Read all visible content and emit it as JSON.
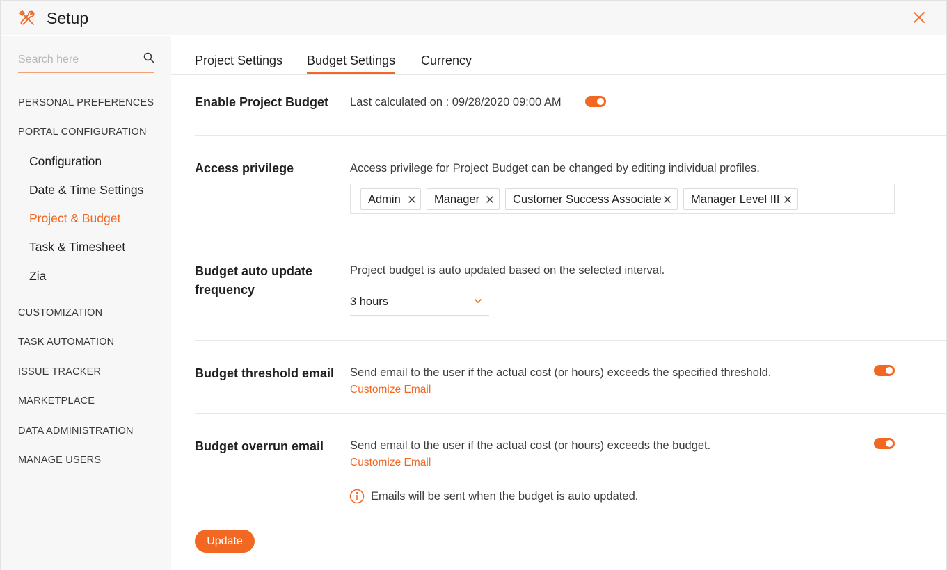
{
  "header": {
    "title": "Setup",
    "logo_icon": "tools-icon",
    "close_icon": "close-icon",
    "accent_color": "#f26722"
  },
  "sidebar": {
    "search": {
      "placeholder": "Search here",
      "value": "",
      "icon": "search-icon"
    },
    "sections": [
      {
        "label": "PERSONAL PREFERENCES"
      },
      {
        "label": "PORTAL CONFIGURATION"
      },
      {
        "label": "CUSTOMIZATION"
      },
      {
        "label": "TASK AUTOMATION"
      },
      {
        "label": "ISSUE TRACKER"
      },
      {
        "label": "MARKETPLACE"
      },
      {
        "label": "DATA ADMINISTRATION"
      },
      {
        "label": "MANAGE USERS"
      }
    ],
    "portal_items": [
      {
        "label": "Configuration",
        "active": false
      },
      {
        "label": "Date & Time Settings",
        "active": false
      },
      {
        "label": "Project & Budget",
        "active": true
      },
      {
        "label": "Task & Timesheet",
        "active": false
      },
      {
        "label": "Zia",
        "active": false
      }
    ]
  },
  "tabs": [
    {
      "label": "Project Settings",
      "active": false
    },
    {
      "label": "Budget Settings",
      "active": true
    },
    {
      "label": "Currency",
      "active": false
    }
  ],
  "settings": {
    "enable_budget": {
      "label": "Enable Project Budget",
      "description": "Last calculated on : 09/28/2020 09:00 AM",
      "enabled": true
    },
    "access_privilege": {
      "label": "Access privilege",
      "description": "Access privilege for Project Budget can be changed by editing individual profiles.",
      "profiles": [
        "Admin",
        "Manager",
        "Customer Success Associate",
        "Manager Level III"
      ]
    },
    "auto_update": {
      "label_line1": "Budget auto update",
      "label_line2": "frequency",
      "description": "Project budget is auto updated based on the selected interval.",
      "selected": "3 hours"
    },
    "threshold_email": {
      "label": "Budget threshold email",
      "description": "Send email to the user if the actual cost (or hours) exceeds the specified threshold.",
      "link": "Customize Email",
      "enabled": true
    },
    "overrun_email": {
      "label": "Budget overrun email",
      "description": "Send email to the user if the actual cost (or hours) exceeds the budget.",
      "link": "Customize Email",
      "enabled": true
    },
    "info_note": "Emails will be sent when the budget is auto updated."
  },
  "footer": {
    "update_label": "Update"
  }
}
